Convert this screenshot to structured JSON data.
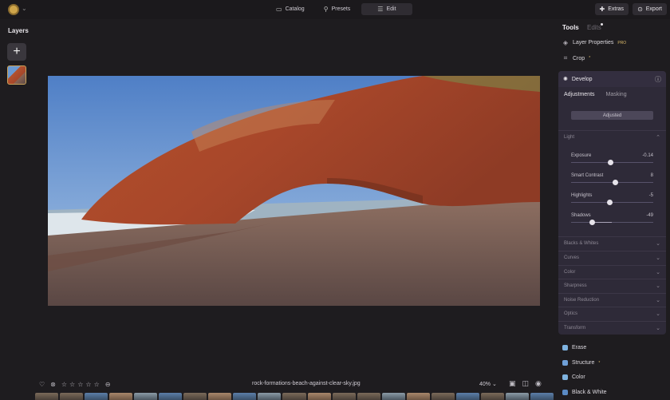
{
  "topbar": {
    "modes": [
      {
        "label": "Catalog",
        "icon": "folder-icon"
      },
      {
        "label": "Presets",
        "icon": "presets-icon"
      },
      {
        "label": "Edit",
        "icon": "edit-icon"
      }
    ],
    "extras_label": "Extras",
    "export_label": "Export"
  },
  "layers": {
    "title": "Layers",
    "add_symbol": "+"
  },
  "image": {
    "filename": "rock-formations-beach-against-clear-sky.jpg",
    "zoom": "40%"
  },
  "right_panel": {
    "tabs": {
      "tools": "Tools",
      "edits": "Edits"
    },
    "layer_properties": "Layer Properties",
    "crop": "Crop",
    "develop": {
      "title": "Develop",
      "tabs": {
        "adjustments": "Adjustments",
        "masking": "Masking"
      },
      "adjusted_label": "Adjusted",
      "light_label": "Light",
      "sliders": [
        {
          "label": "Exposure",
          "display": "-0.14",
          "value": -0.14,
          "min": -4,
          "max": 4
        },
        {
          "label": "Smart Contrast",
          "display": "8",
          "value": 8,
          "min": -100,
          "max": 100
        },
        {
          "label": "Highlights",
          "display": "-5",
          "value": -5,
          "min": -100,
          "max": 100
        },
        {
          "label": "Shadows",
          "display": "-49",
          "value": -49,
          "min": -100,
          "max": 100
        }
      ],
      "sections": [
        "Blacks & Whites",
        "Curves",
        "Color",
        "Sharpness",
        "Noise Reduction",
        "Optics",
        "Transform"
      ]
    },
    "aux_tools": [
      {
        "label": "Erase",
        "color": "#7fb3e0",
        "badge": ""
      },
      {
        "label": "Structure",
        "color": "#6fa0d8",
        "badge": "*"
      },
      {
        "label": "Color",
        "color": "#7fb3e0",
        "badge": ""
      },
      {
        "label": "Black & White",
        "color": "#5a8ac4",
        "badge": ""
      }
    ]
  },
  "colors": {
    "accent": "#d9b86a",
    "panel": "#2e2a38",
    "background": "#1e1c1f"
  }
}
